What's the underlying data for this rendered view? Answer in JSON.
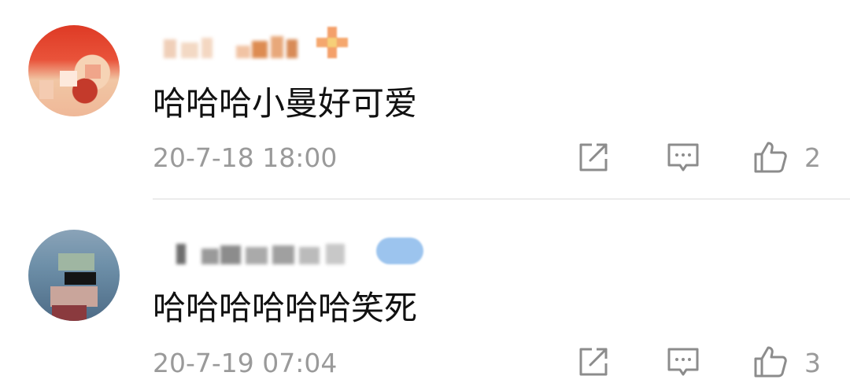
{
  "comments": [
    {
      "text": "哈哈哈小曼好可爱",
      "time": "20-7-18 18:00",
      "like_count": "2"
    },
    {
      "text": "哈哈哈哈哈哈笑死",
      "time": "20-7-19 07:04",
      "like_count": "3"
    }
  ],
  "icons": {
    "share": "share-icon",
    "reply": "comment-icon",
    "like": "thumbs-up-icon"
  },
  "colors": {
    "text": "#111111",
    "meta": "#9a9a9a",
    "divider": "#ececec"
  }
}
